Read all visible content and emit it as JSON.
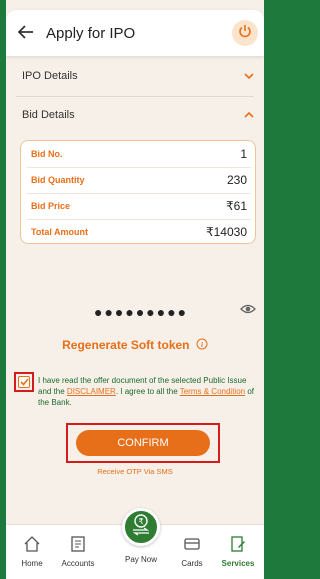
{
  "header": {
    "title": "Apply for IPO"
  },
  "sections": [
    {
      "label": "IPO Details",
      "expanded": false
    },
    {
      "label": "Bid Details",
      "expanded": true
    }
  ],
  "bid_details": [
    {
      "key": "Bid No.",
      "value": "1"
    },
    {
      "key": "Bid Quantity",
      "value": "230"
    },
    {
      "key": "Bid Price",
      "value": "₹61"
    },
    {
      "key": "Total Amount",
      "value": "₹14030"
    }
  ],
  "pin": {
    "masked": "●●●●●●●●●"
  },
  "regen_label": "Regenerate Soft token",
  "terms": {
    "prefix": "I have read the offer document of the selected Public Issue and the ",
    "disclaimer": "DISCLAIMER",
    "middle": ". I agree to all the ",
    "terms_link": "Terms & Condition",
    "suffix": " of the Bank.",
    "checked": true
  },
  "confirm_label": "CONFIRM",
  "otp_label": "Receive OTP Via SMS",
  "nav": {
    "home": "Home",
    "accounts": "Accounts",
    "paynow": "Pay Now",
    "cards": "Cards",
    "services": "Services"
  },
  "colors": {
    "accent": "#e86f1a",
    "brand": "#2e7d32",
    "highlight": "#d41c1c"
  }
}
